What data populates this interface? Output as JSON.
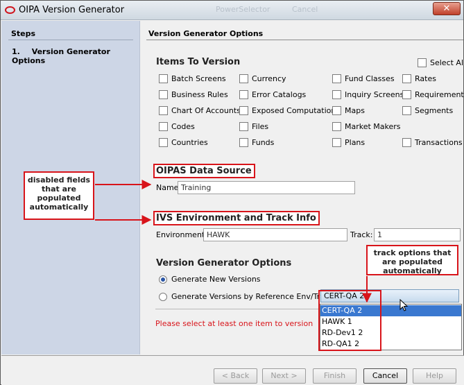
{
  "window": {
    "title": "OIPA Version Generator",
    "ghost_text_1": "PowerSelector",
    "ghost_text_2": "Cancel",
    "close_glyph": "✕"
  },
  "steps": {
    "heading": "Steps",
    "items": [
      {
        "number": "1.",
        "label": "Version Generator Options"
      }
    ]
  },
  "content": {
    "heading": "Version Generator Options",
    "items_to_version": {
      "title": "Items To Version",
      "select_all": "Select All",
      "checkboxes": [
        "Batch Screens",
        "Currency",
        "Fund Classes",
        "Rates",
        "Business Rules",
        "Error Catalogs",
        "Inquiry Screens",
        "Requirements",
        "Chart Of Accounts",
        "Exposed Computations",
        "Maps",
        "Segments",
        "Codes",
        "Files",
        "Market Makers",
        "Countries",
        "Funds",
        "Plans",
        "Transactions"
      ]
    },
    "data_source": {
      "title": "OIPAS Data Source",
      "name_label": "Name",
      "name_value": "Training"
    },
    "ivs": {
      "title": "IVS Environment and Track Info",
      "env_label": "Environment:",
      "env_value": "HAWK",
      "track_label": "Track:",
      "track_value": "1"
    },
    "vgo": {
      "title": "Version Generator Options",
      "radio_new": "Generate New Versions",
      "radio_ref": "Generate Versions by Reference Env/Track:",
      "combo_value": "CERT-QA 2",
      "options": [
        "CERT-QA 2",
        "HAWK 1",
        "RD-Dev1 2",
        "RD-QA1 2"
      ]
    },
    "error": "Please select at least one item to version"
  },
  "buttons": {
    "back": "< Back",
    "next": "Next >",
    "finish": "Finish",
    "cancel": "Cancel",
    "help": "Help"
  },
  "annotations": {
    "disabled_fields": "disabled fields that are populated automatically",
    "track_options": "track options that are populated automatically"
  },
  "colors": {
    "accent_red": "#d8141a",
    "selection_blue": "#3a78d0",
    "steps_panel": "#cdd6e6"
  }
}
